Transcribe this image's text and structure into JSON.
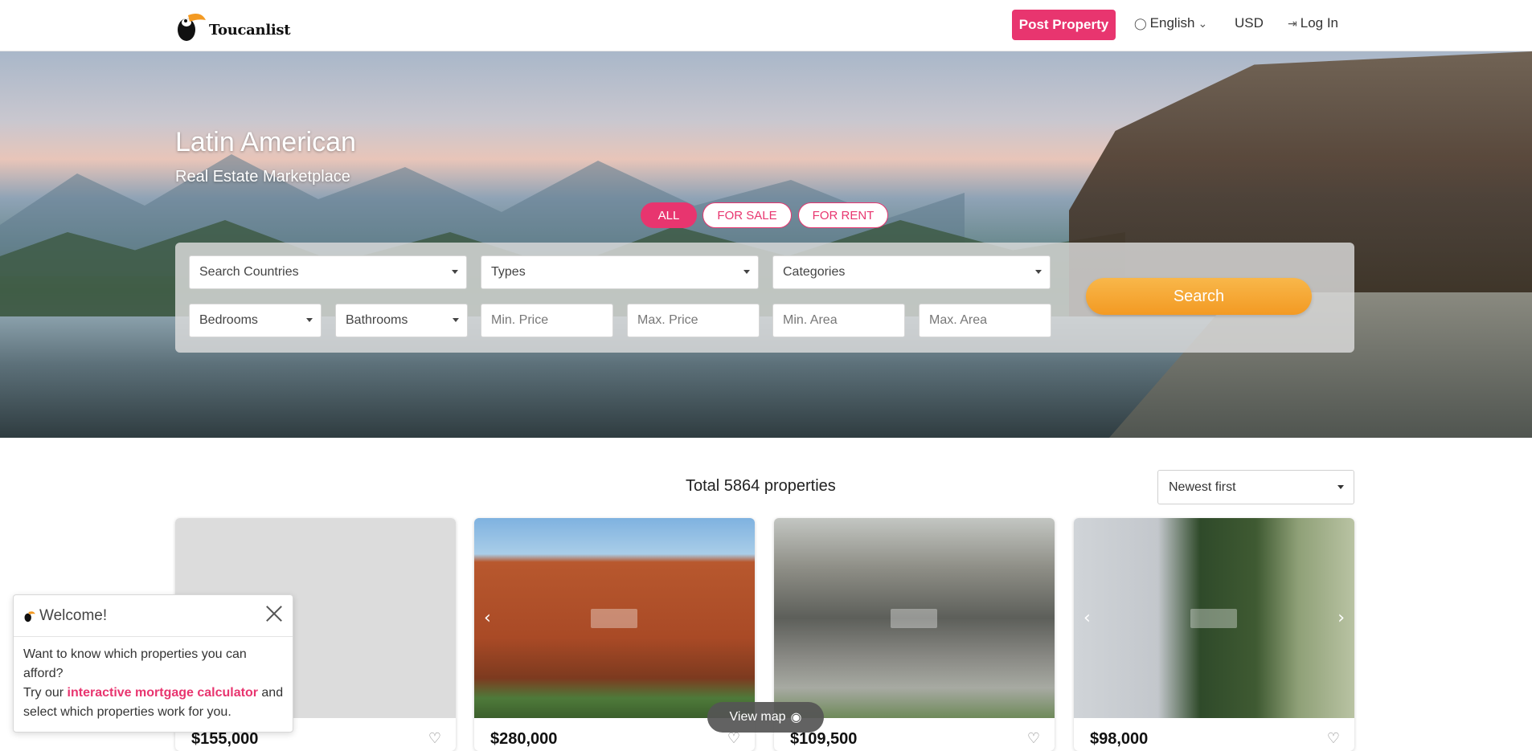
{
  "header": {
    "logo_text": "Toucanlist",
    "post_button": "Post Property",
    "language": "English",
    "currency": "USD",
    "login": "Log In"
  },
  "hero": {
    "title": "Latin American",
    "subtitle": "Real Estate Marketplace",
    "tabs": [
      {
        "label": "ALL",
        "active": true
      },
      {
        "label": "FOR SALE",
        "active": false
      },
      {
        "label": "FOR RENT",
        "active": false
      }
    ]
  },
  "search": {
    "country": "Search Countries",
    "types": "Types",
    "categories": "Categories",
    "bedrooms": "Bedrooms",
    "bathrooms": "Bathrooms",
    "min_price_placeholder": "Min. Price",
    "max_price_placeholder": "Max. Price",
    "min_area_placeholder": "Min. Area",
    "max_area_placeholder": "Max. Area",
    "button": "Search"
  },
  "results": {
    "total": "Total 5864 properties",
    "sort": "Newest first",
    "view_map": "View map",
    "cards": [
      {
        "price": "$155,000"
      },
      {
        "price": "$280,000"
      },
      {
        "price": "$109,500"
      },
      {
        "price": "$98,000"
      }
    ]
  },
  "welcome": {
    "title": "Welcome!",
    "line1": "Want to know which properties you can afford?",
    "line2_prefix": "Try our ",
    "link": "interactive mortgage calculator",
    "line2_suffix": " and select which properties work for you."
  },
  "colors": {
    "accent_pink": "#e8356f",
    "search_orange": "#f5a733"
  },
  "icons": [
    "toucan-logo",
    "globe-icon",
    "chevron-down-icon",
    "login-icon",
    "heart-icon",
    "chevron-left-icon",
    "chevron-right-icon",
    "globe-map-icon",
    "close-icon"
  ]
}
